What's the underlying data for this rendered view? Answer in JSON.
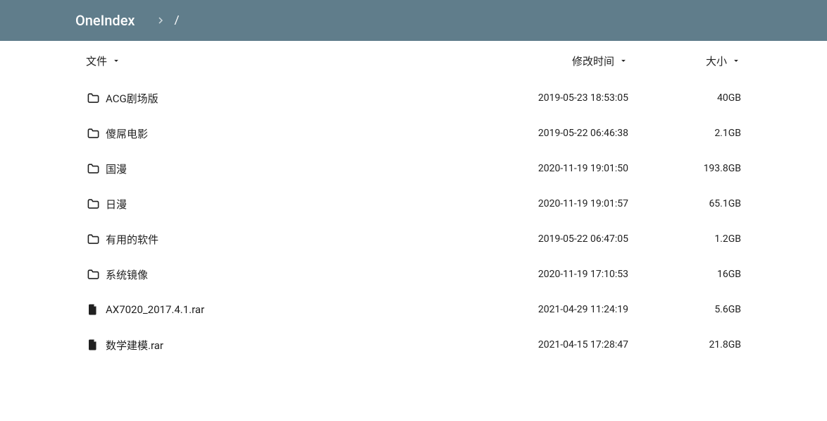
{
  "header": {
    "brand": "OneIndex",
    "breadcrumb_path": "/"
  },
  "columns": {
    "name_label": "文件",
    "date_label": "修改时间",
    "size_label": "大小"
  },
  "items": [
    {
      "type": "folder",
      "name": "ACG剧场版",
      "date": "2019-05-23 18:53:05",
      "size": "40GB"
    },
    {
      "type": "folder",
      "name": "傻屌电影",
      "date": "2019-05-22 06:46:38",
      "size": "2.1GB"
    },
    {
      "type": "folder",
      "name": "国漫",
      "date": "2020-11-19 19:01:50",
      "size": "193.8GB"
    },
    {
      "type": "folder",
      "name": "日漫",
      "date": "2020-11-19 19:01:57",
      "size": "65.1GB"
    },
    {
      "type": "folder",
      "name": "有用的软件",
      "date": "2019-05-22 06:47:05",
      "size": "1.2GB"
    },
    {
      "type": "folder",
      "name": "系统镜像",
      "date": "2020-11-19 17:10:53",
      "size": "16GB"
    },
    {
      "type": "file",
      "name": "AX7020_2017.4.1.rar",
      "date": "2021-04-29 11:24:19",
      "size": "5.6GB"
    },
    {
      "type": "file",
      "name": "数学建模.rar",
      "date": "2021-04-15 17:28:47",
      "size": "21.8GB"
    }
  ]
}
